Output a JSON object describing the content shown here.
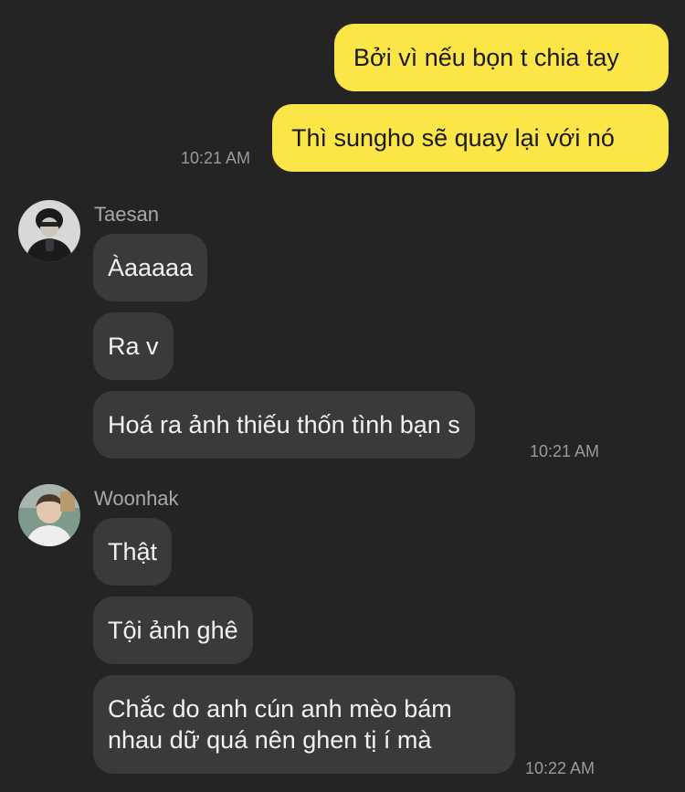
{
  "colors": {
    "background": "#242424",
    "my_bubble": "#fce547",
    "their_bubble": "#3a3a3c",
    "timestamp": "#9a9a9a"
  },
  "outgoing": {
    "messages": [
      "Bởi vì nếu bọn t chia tay",
      "Thì sungho sẽ quay lại với nó"
    ],
    "time": "10:21 AM"
  },
  "senders": [
    {
      "name": "Taesan",
      "avatar_icon": "profile-photo",
      "messages": [
        "Àaaaaa",
        "Ra v",
        "Hoá ra ảnh thiếu thốn tình bạn s"
      ],
      "time": "10:21 AM"
    },
    {
      "name": "Woonhak",
      "avatar_icon": "profile-photo",
      "messages": [
        "Thật",
        "Tội ảnh ghê",
        "Chắc do anh cún anh mèo bám nhau dữ quá nên ghen tị í mà"
      ],
      "time": "10:22 AM"
    }
  ]
}
